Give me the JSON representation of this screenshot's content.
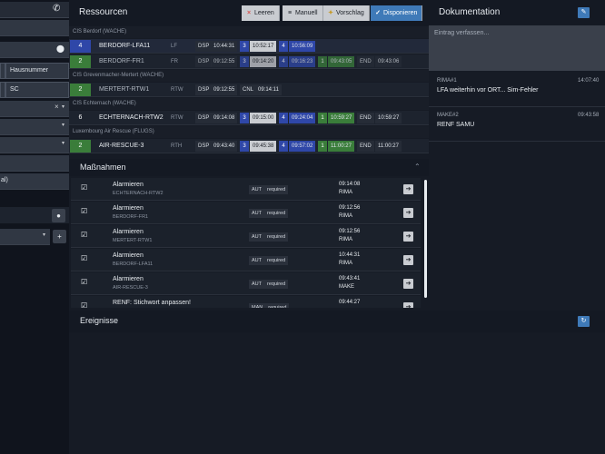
{
  "left": {
    "phone_icon": "phone-icon",
    "house_number_placeholder": "Hausnummer",
    "sc_value": "SC",
    "clear_x": "×",
    "fragment_text": "al)",
    "plus": "+"
  },
  "resources": {
    "title": "Ressourcen",
    "toolbar": [
      {
        "icon": "×",
        "label": "Leeren",
        "name": "clear-button",
        "icon_color": "#d9534f"
      },
      {
        "icon": "≡",
        "label": "Manuell",
        "name": "manual-button",
        "icon_color": "#1b1f26"
      },
      {
        "icon": "✦",
        "label": "Vorschlag",
        "name": "suggest-button",
        "icon_color": "#c69b2a"
      },
      {
        "icon": "✓",
        "label": "Disponieren",
        "name": "dispatch-button",
        "icon_color": "#ffffff"
      }
    ],
    "groups": [
      {
        "label": "CIS Berdorf (WACHE)",
        "rows": [
          {
            "count": "4",
            "count_color": "#2f47a8",
            "name": "BERDORF-LFA11",
            "type": "LF",
            "highlight": true,
            "faded": false,
            "tags": [
              {
                "label": "DSP",
                "value": "10:44:31",
                "num": "3",
                "value2": "10:52:17",
                "num_color": "#2f47a8",
                "v2_color": "#c9ccd1",
                "num2": "4",
                "value3": "10:56:09",
                "v3_color": "#2f47a8"
              }
            ]
          },
          {
            "count": "2",
            "count_color": "#3a7d3a",
            "name": "BERDORF-FR1",
            "type": "FR",
            "highlight": false,
            "faded": true,
            "full": [
              "DSP",
              "09:12:55",
              "3",
              "09:14:20",
              "4",
              "09:16:23",
              "1",
              "09:43:05",
              "END",
              "09:43:06"
            ]
          }
        ]
      },
      {
        "label": "CIS Grevenmacher-Mertert (WACHE)",
        "rows": [
          {
            "count": "2",
            "count_color": "#3a7d3a",
            "name": "MERTERT-RTW1",
            "type": "RTW",
            "faded": true,
            "simple": [
              "DSP",
              "09:12:55",
              "CNL",
              "09:14:11"
            ]
          }
        ]
      },
      {
        "label": "CIS Echternach (WACHE)",
        "rows": [
          {
            "count": "6",
            "count_color": "#1d232e",
            "name": "ECHTERNACH-RTW2",
            "type": "RTW",
            "faded": false,
            "full": [
              "DSP",
              "09:14:08",
              "3",
              "09:15:00",
              "4",
              "09:24:04",
              "1",
              "10:59:27",
              "END",
              "10:59:27"
            ]
          }
        ]
      },
      {
        "label": "Luxembourg Air Rescue (FLUGS)",
        "rows": [
          {
            "count": "2",
            "count_color": "#3a7d3a",
            "name": "AIR-RESCUE-3",
            "type": "RTH",
            "faded": false,
            "full": [
              "DSP",
              "09:43:40",
              "3",
              "09:45:38",
              "4",
              "09:57:02",
              "1",
              "11:00:27",
              "END",
              "11:00:27"
            ]
          }
        ]
      }
    ]
  },
  "massnahmen": {
    "title": "Maßnahmen",
    "collapse_icon": "chevron-up-icon",
    "rows": [
      {
        "title": "Alarmieren",
        "sub": "ECHTERNACH-RTW2",
        "mode": "AUT",
        "status": "required",
        "time": "09:14:08",
        "user": "RIMA"
      },
      {
        "title": "Alarmieren",
        "sub": "BERDORF-FR1",
        "mode": "AUT",
        "status": "required",
        "time": "09:12:56",
        "user": "RIMA"
      },
      {
        "title": "Alarmieren",
        "sub": "MERTERT-RTW1",
        "mode": "AUT",
        "status": "required",
        "time": "09:12:56",
        "user": "RIMA"
      },
      {
        "title": "Alarmieren",
        "sub": "BERDORF-LFA11",
        "mode": "AUT",
        "status": "required",
        "time": "10:44:31",
        "user": "RIMA"
      },
      {
        "title": "Alarmieren",
        "sub": "AIR-RESCUE-3",
        "mode": "AUT",
        "status": "required",
        "time": "09:43:41",
        "user": "MAKE"
      },
      {
        "title": "RENF: Stichwort anpassen!",
        "sub": "",
        "mode": "MAN",
        "status": "required",
        "time": "09:44:27",
        "user": ""
      }
    ]
  },
  "ereignisse": {
    "title": "Ereignisse",
    "refresh_icon": "refresh-icon"
  },
  "documentation": {
    "title": "Dokumentation",
    "edit_icon": "pencil-icon",
    "placeholder": "Eintrag verfassen...",
    "entries": [
      {
        "author": "RIMA#1",
        "time": "14:07:40",
        "text": "LFA weiterhin vor ORT... Sim-Fehler"
      },
      {
        "author": "MAKE#2",
        "time": "09:43:58",
        "text": "RENF SAMU"
      }
    ]
  }
}
